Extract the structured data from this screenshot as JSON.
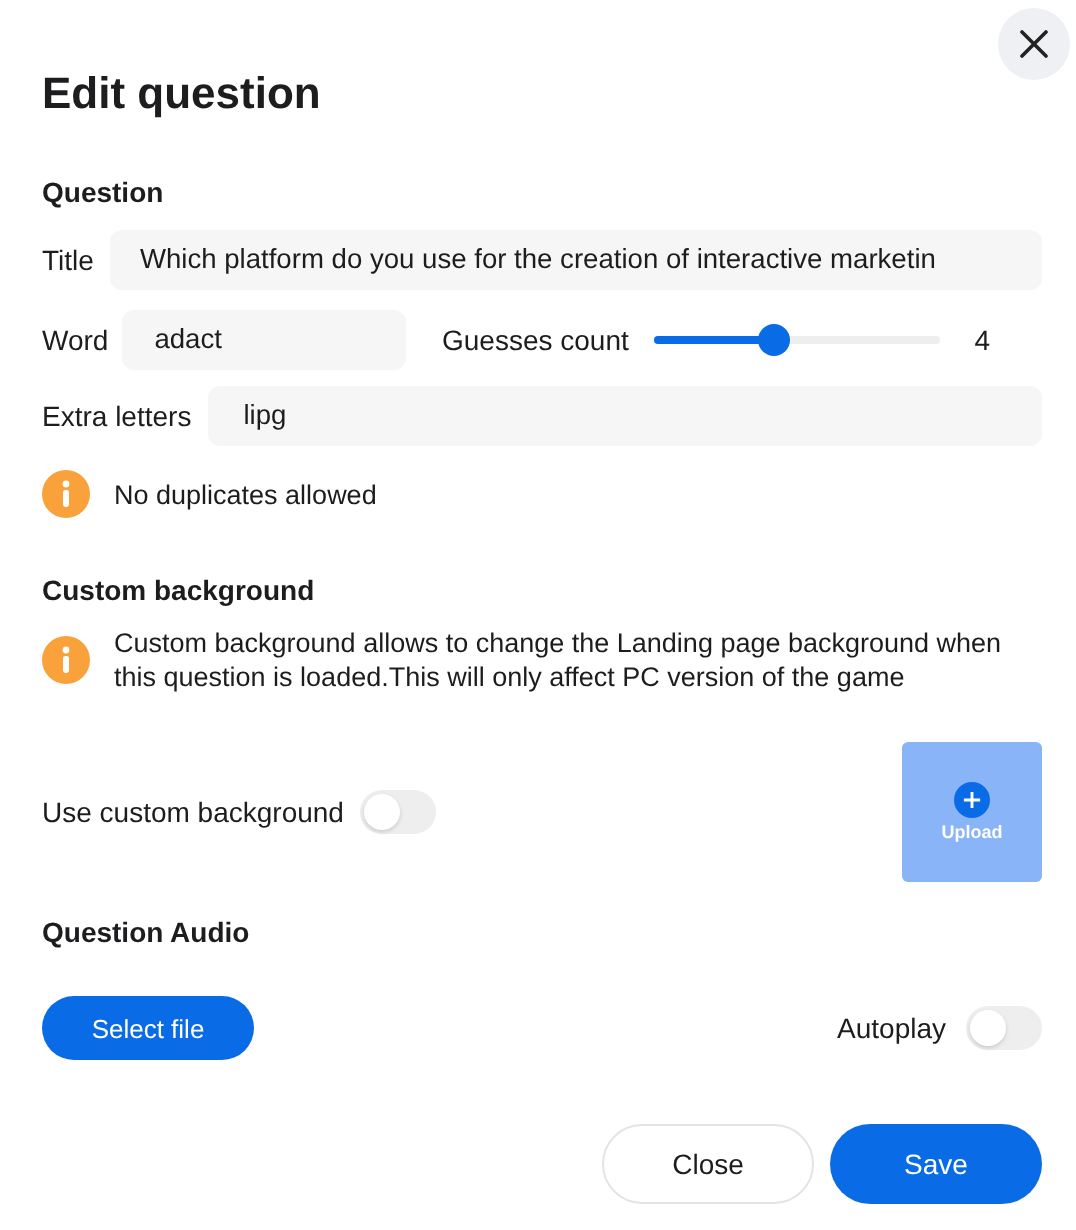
{
  "dialog": {
    "title": "Edit question"
  },
  "question_section": {
    "heading": "Question",
    "title_field": {
      "label": "Title",
      "value": "Which platform do you use for the creation of interactive marketin"
    },
    "word_field": {
      "label": "Word",
      "value": "adact"
    },
    "guesses": {
      "label": "Guesses count",
      "level": 0.42,
      "reading": "4"
    },
    "extra_letters_field": {
      "label": "Extra letters",
      "value": "lipg"
    },
    "note": "No duplicates allowed"
  },
  "background_section": {
    "heading": "Custom background",
    "note": "Custom background allows to change the Landing page background when this question is loaded.This will only affect PC version of the game",
    "toggle": {
      "label": "Use custom background",
      "on": false
    },
    "upload": {
      "label": "Upload",
      "disabled": true
    }
  },
  "audio_section": {
    "heading": "Question Audio",
    "select_button": "Select file",
    "autoplay": {
      "label": "Autoplay",
      "on": false
    }
  },
  "buttons": [
    {
      "label": "Close",
      "kind": "secondary"
    },
    {
      "label": "Save",
      "kind": "primary"
    }
  ]
}
